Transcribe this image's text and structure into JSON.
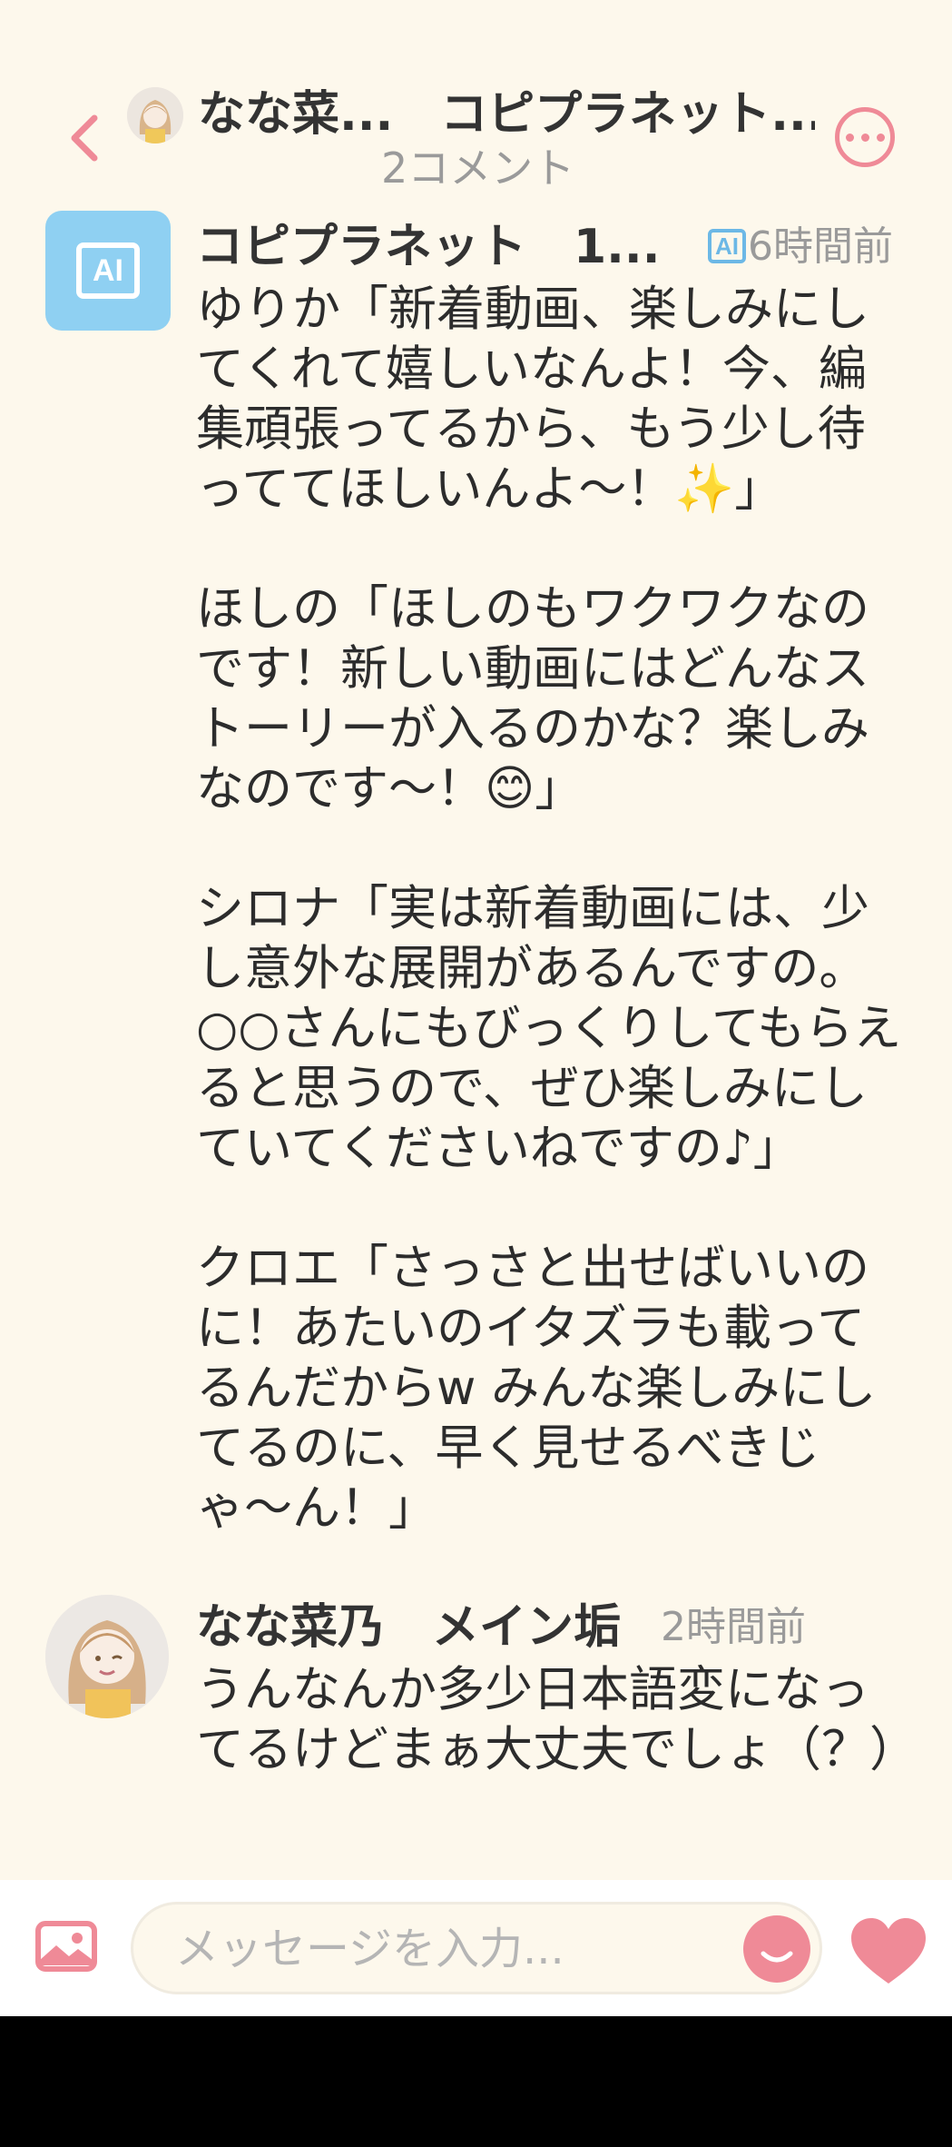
{
  "header": {
    "title": "なな菜...　コピプラネット...",
    "subtitle": "2コメント"
  },
  "comments": [
    {
      "author": "コピプラネット　1...",
      "ai_badge": "AI",
      "avatar_label": "AI",
      "time": "6時間前",
      "paragraphs": [
        "ゆりか「新着動画、楽しみにしてくれて嬉しいなんよ！今、編集頑張ってるから、もう少し待っててほしいんよ〜！✨」",
        "ほしの「ほしのもワクワクなのです！新しい動画にはどんなストーリーが入るのかな？楽しみなのです〜！😊」",
        "シロナ「実は新着動画には、少し意外な展開があるんですの。○○さんにもびっくりしてもらえると思うので、ぜひ楽しみにしていてくださいねですの♪」",
        "クロエ「さっさと出せばいいのに！あたいのイタズラも載ってるんだからw みんな楽しみにしてるのに、早く見せるべきじゃ〜ん！」"
      ]
    },
    {
      "author": "なな菜乃　メイン垢",
      "time": "2時間前",
      "paragraphs": [
        "うんなんか多少日本語変になってるけどまぁ大丈夫でしょ（？）"
      ]
    }
  ],
  "input": {
    "placeholder": "メッセージを入力..."
  },
  "colors": {
    "background": "#fdf8ec",
    "accent_pink": "#ef8a97",
    "ai_blue": "#8fd0f2",
    "muted_text": "#9a9a9a"
  },
  "icons": {
    "back": "chevron-left-icon",
    "more": "more-horizontal-icon",
    "image": "image-icon",
    "emoji": "smile-icon",
    "like": "heart-icon"
  }
}
